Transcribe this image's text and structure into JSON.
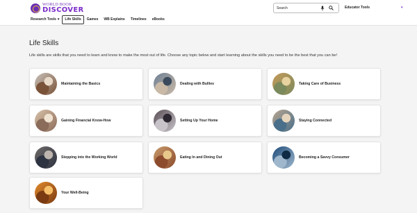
{
  "brand": {
    "line1": "WORLD BOOK",
    "line2": "DISCOVER"
  },
  "nav": [
    {
      "label": "Research Tools",
      "caret": "▾"
    },
    {
      "label": "Life Skills"
    },
    {
      "label": "Games"
    },
    {
      "label": "WB Explains"
    },
    {
      "label": "Timelines"
    },
    {
      "label": "eBooks"
    }
  ],
  "search": {
    "placeholder": "Search"
  },
  "educator_tools": "Educator Tools",
  "profile_caret": "▾",
  "page": {
    "title": "Life Skills",
    "intro": "Life skills are skills that you need to learn and know to make the most out of life. Choose any topic below and start learning about the skills you need to be the best that you can be!"
  },
  "topics": [
    {
      "label": "Maintaining the Basics",
      "colors": [
        "#c9c2bb",
        "#7a5238",
        "#e8d9c8"
      ]
    },
    {
      "label": "Dealing with Bullies",
      "colors": [
        "#6d7f95",
        "#c9b9a6",
        "#3b4a5c"
      ]
    },
    {
      "label": "Taking Care of Business",
      "colors": [
        "#c49a5a",
        "#7b8a5c",
        "#e7d2a0"
      ]
    },
    {
      "label": "Gaining Financial Know-How",
      "colors": [
        "#d8c1a8",
        "#8b6b5a",
        "#f0e2d0"
      ]
    },
    {
      "label": "Setting Up Your Home",
      "colors": [
        "#5a4f56",
        "#c7c3c8",
        "#2c2730"
      ]
    },
    {
      "label": "Staying Connected",
      "colors": [
        "#b8a58f",
        "#4a6f8a",
        "#e6d5bd"
      ]
    },
    {
      "label": "Stepping into the Working World",
      "colors": [
        "#6f6a69",
        "#2d3340",
        "#bdb5ae"
      ]
    },
    {
      "label": "Eating In and Dining Out",
      "colors": [
        "#c79a6a",
        "#8d4b2d",
        "#e8c88a"
      ]
    },
    {
      "label": "Becoming a Savvy Consumer",
      "colors": [
        "#1f4c7a",
        "#9fb7cc",
        "#0f2a44"
      ]
    },
    {
      "label": "Your Well-Being",
      "colors": [
        "#e28a2b",
        "#7a3b12",
        "#f6c06a"
      ]
    }
  ]
}
